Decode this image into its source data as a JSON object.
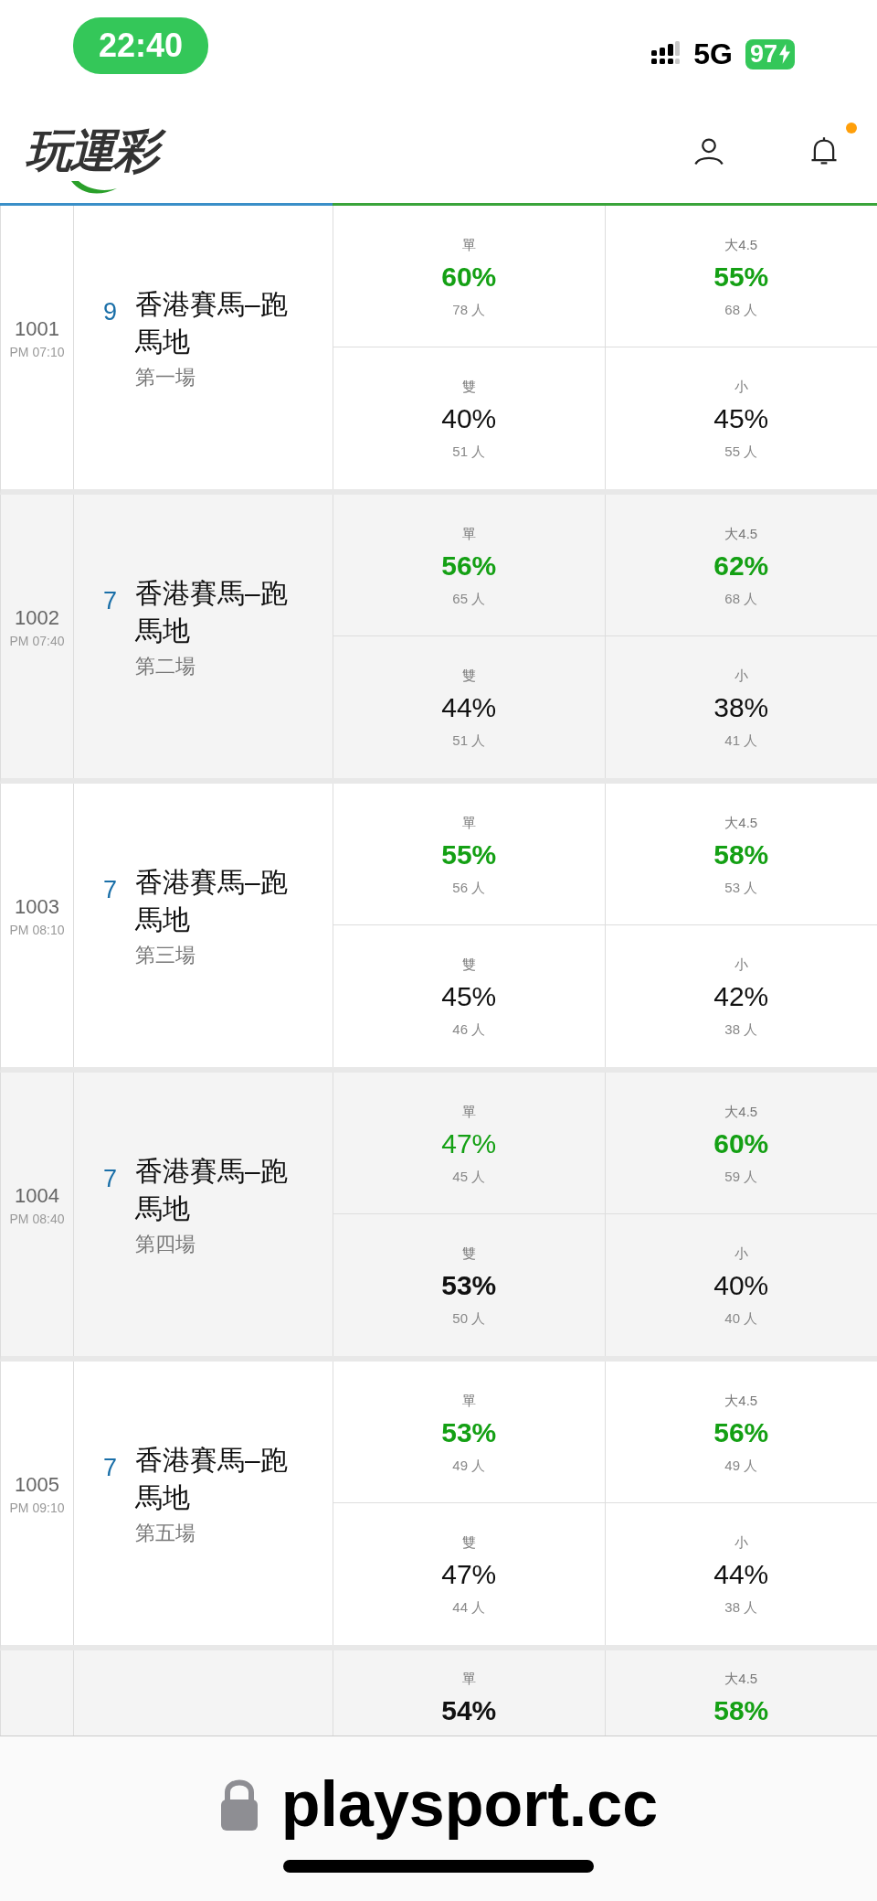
{
  "status_bar": {
    "time": "22:40",
    "network": "5G",
    "battery": "97",
    "charging": true
  },
  "header": {
    "logo": "玩運彩",
    "unread": true
  },
  "rows": [
    {
      "code": "1001",
      "time": "PM 07:10",
      "race_no": "9",
      "venue": "香港賽馬–跑馬地",
      "race": "第一場",
      "picks": [
        {
          "label": "單",
          "value": "60%",
          "count": "78 人",
          "highlighted": true,
          "bold": true
        },
        {
          "label": "大4.5",
          "value": "55%",
          "count": "68 人",
          "highlighted": true,
          "bold": true
        },
        {
          "label": "雙",
          "value": "40%",
          "count": "51 人",
          "highlighted": false,
          "bold": false
        },
        {
          "label": "小",
          "value": "45%",
          "count": "55 人",
          "highlighted": false,
          "bold": false
        }
      ]
    },
    {
      "code": "1002",
      "time": "PM 07:40",
      "race_no": "7",
      "venue": "香港賽馬–跑馬地",
      "race": "第二場",
      "picks": [
        {
          "label": "單",
          "value": "56%",
          "count": "65 人",
          "highlighted": true,
          "bold": true
        },
        {
          "label": "大4.5",
          "value": "62%",
          "count": "68 人",
          "highlighted": true,
          "bold": true
        },
        {
          "label": "雙",
          "value": "44%",
          "count": "51 人",
          "highlighted": false,
          "bold": false
        },
        {
          "label": "小",
          "value": "38%",
          "count": "41 人",
          "highlighted": false,
          "bold": false
        }
      ]
    },
    {
      "code": "1003",
      "time": "PM 08:10",
      "race_no": "7",
      "venue": "香港賽馬–跑馬地",
      "race": "第三場",
      "picks": [
        {
          "label": "單",
          "value": "55%",
          "count": "56 人",
          "highlighted": true,
          "bold": true
        },
        {
          "label": "大4.5",
          "value": "58%",
          "count": "53 人",
          "highlighted": true,
          "bold": true
        },
        {
          "label": "雙",
          "value": "45%",
          "count": "46 人",
          "highlighted": false,
          "bold": false
        },
        {
          "label": "小",
          "value": "42%",
          "count": "38 人",
          "highlighted": false,
          "bold": false
        }
      ]
    },
    {
      "code": "1004",
      "time": "PM 08:40",
      "race_no": "7",
      "venue": "香港賽馬–跑馬地",
      "race": "第四場",
      "picks": [
        {
          "label": "單",
          "value": "47%",
          "count": "45 人",
          "highlighted": true,
          "bold": false
        },
        {
          "label": "大4.5",
          "value": "60%",
          "count": "59 人",
          "highlighted": true,
          "bold": true
        },
        {
          "label": "雙",
          "value": "53%",
          "count": "50 人",
          "highlighted": false,
          "bold": true
        },
        {
          "label": "小",
          "value": "40%",
          "count": "40 人",
          "highlighted": false,
          "bold": false
        }
      ]
    },
    {
      "code": "1005",
      "time": "PM 09:10",
      "race_no": "7",
      "venue": "香港賽馬–跑馬地",
      "race": "第五場",
      "picks": [
        {
          "label": "單",
          "value": "53%",
          "count": "49 人",
          "highlighted": true,
          "bold": true
        },
        {
          "label": "大4.5",
          "value": "56%",
          "count": "49 人",
          "highlighted": true,
          "bold": true
        },
        {
          "label": "雙",
          "value": "47%",
          "count": "44 人",
          "highlighted": false,
          "bold": false
        },
        {
          "label": "小",
          "value": "44%",
          "count": "38 人",
          "highlighted": false,
          "bold": false
        }
      ]
    },
    {
      "picks": [
        {
          "label": "單",
          "value": "54%",
          "highlighted": false,
          "bold": true
        },
        {
          "label": "大4.5",
          "value": "58%",
          "highlighted": true,
          "bold": true
        }
      ]
    }
  ],
  "address_bar": {
    "url": "playsport.cc"
  }
}
